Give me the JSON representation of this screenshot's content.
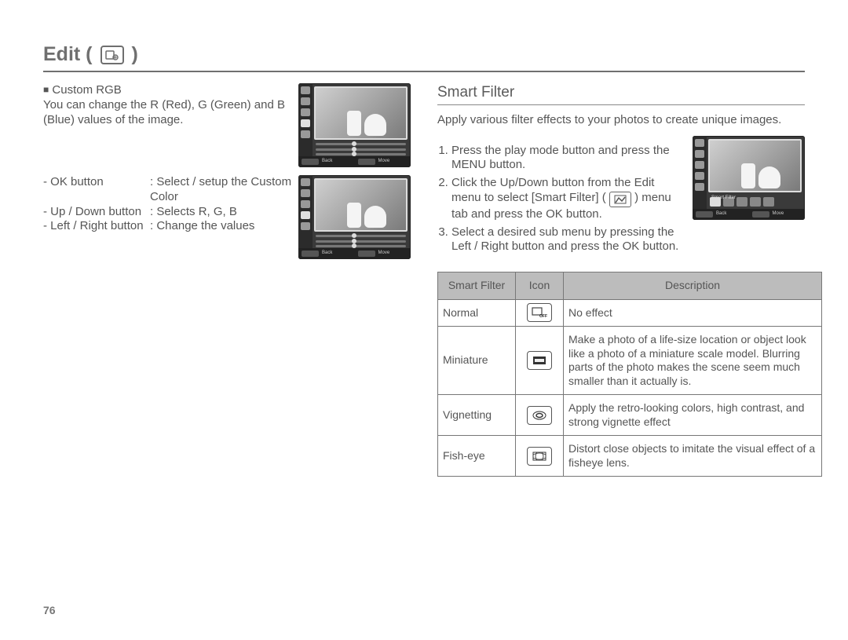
{
  "page_number": "76",
  "heading": "Edit (",
  "heading_close": ")",
  "left": {
    "custom_rgb_title": "Custom RGB",
    "custom_rgb_desc": "You can change the R (Red), G (Green) and B (Blue) values of the image.",
    "note1_a": "- OK button",
    "note1_b": ": Select / setup the Custom Color",
    "note2_a": "- Up / Down button",
    "note2_b": ": Selects R, G, B",
    "note3_a": "- Left / Right button",
    "note3_b": ": Change the values"
  },
  "screens": {
    "back": "Back",
    "move": "Move",
    "smart_filter_label": "Smart Filter"
  },
  "right": {
    "subhead": "Smart Filter",
    "intro": "Apply various filter effects to your photos to create unique images.",
    "step1": "Press the play mode button and press the MENU button.",
    "step2a": "Click the Up/Down button from the Edit menu to select [Smart Filter] (",
    "step2b": ") menu tab and press the OK button.",
    "step3": "Select a desired sub menu by pressing the Left / Right button and press the OK button."
  },
  "table": {
    "headers": [
      "Smart Filter",
      "Icon",
      "Description"
    ],
    "rows": [
      {
        "name": "Normal",
        "icon": "off",
        "desc": "No effect"
      },
      {
        "name": "Miniature",
        "icon": "miniature",
        "desc": "Make a photo of a life-size location or object look like a photo of a miniature scale model. Blurring parts of the photo makes the scene seem much smaller than it actually is."
      },
      {
        "name": "Vignetting",
        "icon": "vignette",
        "desc": "Apply the retro-looking colors, high contrast, and strong vignette effect"
      },
      {
        "name": "Fish-eye",
        "icon": "fisheye",
        "desc": "Distort close objects to imitate the visual effect of a fisheye lens."
      }
    ]
  }
}
